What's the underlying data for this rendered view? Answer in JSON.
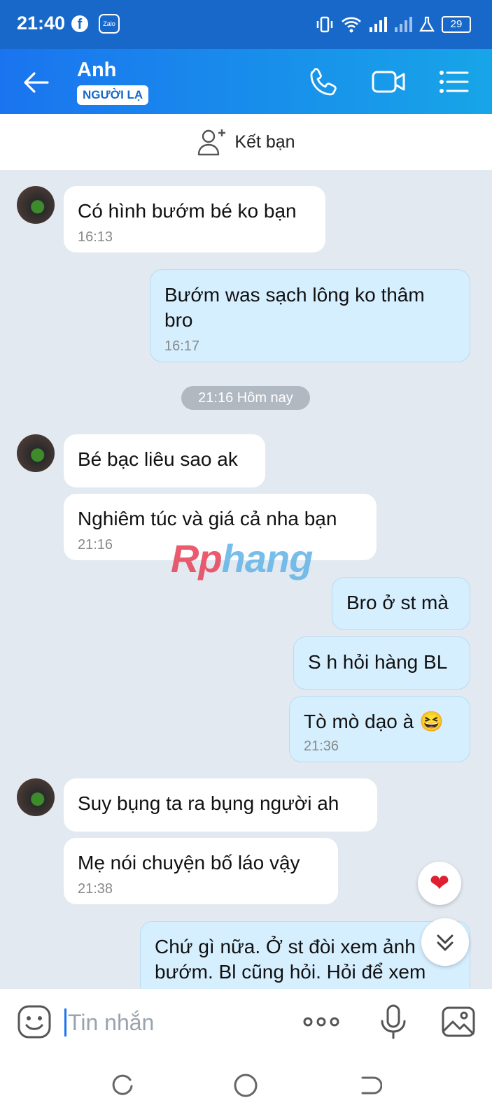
{
  "status_bar": {
    "time": "21:40",
    "fb_glyph": "f",
    "zalo_label": "Zalo",
    "battery": "29",
    "icons": [
      "facebook-icon",
      "zalo-icon",
      "vibrate-icon",
      "wifi-icon",
      "signal-icon",
      "signal-icon",
      "beaker-icon",
      "battery-icon"
    ]
  },
  "header": {
    "contact_name": "Anh",
    "badge": "NGƯỜI LẠ",
    "icons": [
      "back-arrow-icon",
      "phone-icon",
      "video-call-icon",
      "menu-list-icon"
    ]
  },
  "add_friend": {
    "label": "Kết bạn",
    "icon": "add-user-icon"
  },
  "messages": [
    {
      "dir": "in",
      "text": "Có hình bướm bé ko bạn",
      "time": "16:13"
    },
    {
      "dir": "out",
      "line1": "Bướm was sạch lông ko thâm",
      "line2": "bro",
      "time": "16:17"
    },
    {
      "dir": "in",
      "text": "Bé bạc liêu sao ak"
    },
    {
      "dir": "in",
      "text": "Nghiêm túc và giá cả nha bạn",
      "time": "21:16"
    },
    {
      "dir": "out",
      "text": "Bro ở st mà"
    },
    {
      "dir": "out",
      "text": "S h hỏi hàng BL"
    },
    {
      "dir": "out",
      "text": "Tò mò dạo à 😆",
      "time": "21:36"
    },
    {
      "dir": "in",
      "text": "Suy bụng ta ra bụng người ah"
    },
    {
      "dir": "in",
      "text": "Mẹ nói chuyện bố láo vậy",
      "time": "21:38"
    },
    {
      "dir": "out",
      "line1": "Chứ gì nữa. Ở st đòi xem ảnh",
      "line2": "bướm. Bl cũng hỏi. Hỏi để xem"
    }
  ],
  "date_divider": "21:16 Hôm nay",
  "watermark": {
    "part1": "Rp",
    "part2": "hang"
  },
  "reaction": "❤",
  "input": {
    "placeholder": "Tin nhắn",
    "icons": [
      "emoji-icon",
      "more-icon",
      "mic-icon",
      "gallery-icon"
    ]
  },
  "nav": {
    "icons": [
      "recent-apps-icon",
      "home-icon",
      "back-icon"
    ]
  },
  "colors": {
    "header_start": "#1a74ef",
    "header_end": "#17a5e8",
    "out_bubble": "#d6efff",
    "chat_bg": "#e2e9f1"
  }
}
